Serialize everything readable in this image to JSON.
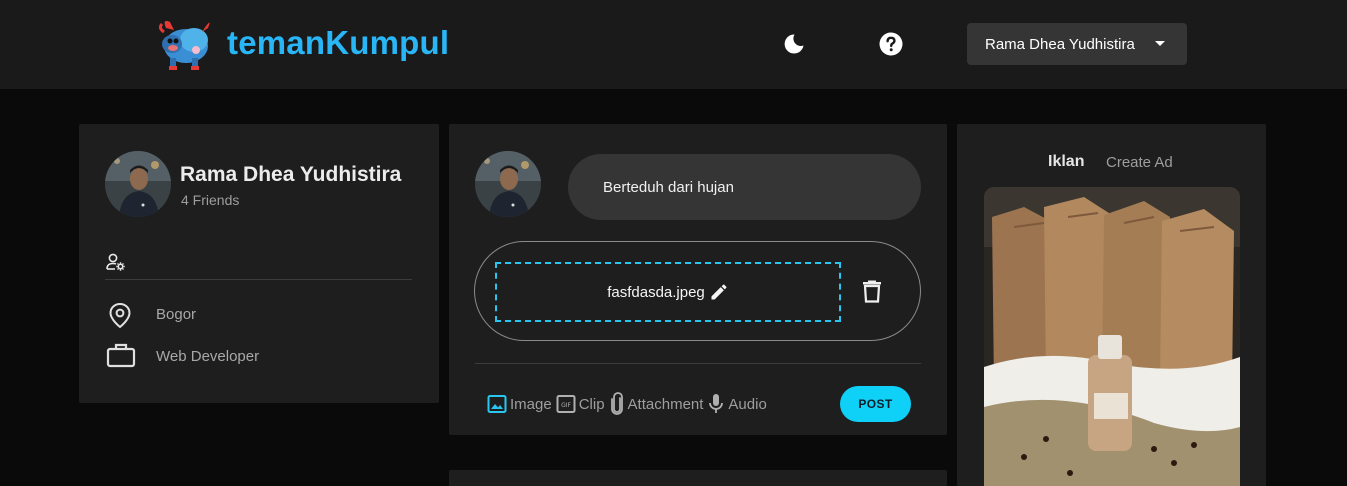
{
  "header": {
    "brand": "temanKumpul",
    "user_name": "Rama Dhea Yudhistira",
    "icons": [
      "moon-icon",
      "help-icon",
      "caret-down-icon"
    ]
  },
  "profile": {
    "name": "Rama Dhea Yudhistira",
    "friends": "4 Friends",
    "location": "Bogor",
    "occupation": "Web Developer"
  },
  "composer": {
    "text": "Berteduh dari hujan",
    "file_name": "fasfdasda.jpeg",
    "actions": {
      "image": "Image",
      "clip": "Clip",
      "attachment": "Attachment",
      "audio": "Audio"
    },
    "post_label": "POST"
  },
  "ads": {
    "title": "Iklan",
    "create_label": "Create Ad"
  },
  "colors": {
    "accent": "#29b6f6",
    "post_button": "#0fd0f7",
    "card": "#1e1e1e",
    "background": "#0a0a0a"
  }
}
